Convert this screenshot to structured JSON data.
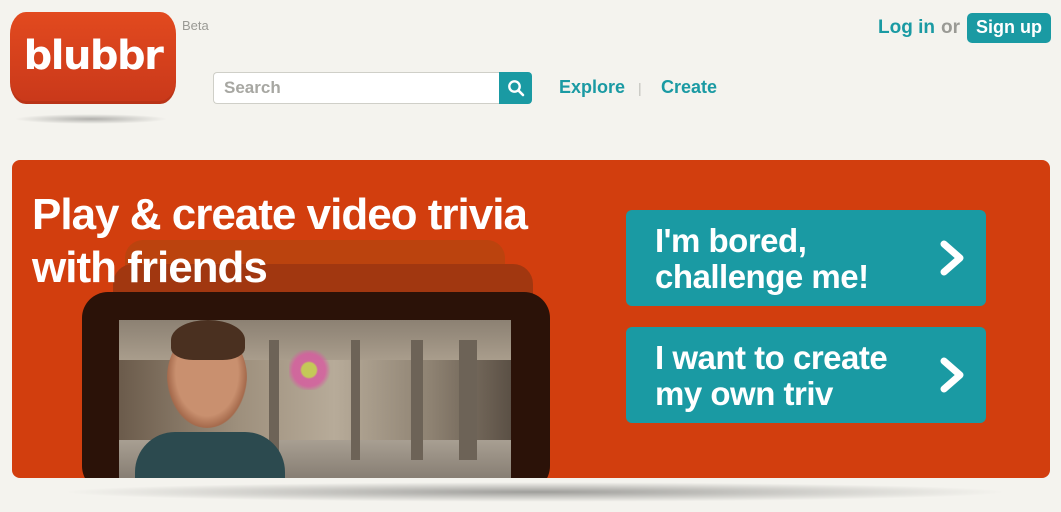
{
  "header": {
    "logo_text": "blubbr",
    "beta_label": "Beta",
    "search": {
      "placeholder": "Search",
      "value": "",
      "button_icon": "search-icon"
    },
    "nav": [
      {
        "label": "Explore"
      },
      {
        "label": "Create"
      }
    ],
    "nav_separator": "|",
    "auth": {
      "login_label": "Log in",
      "or_label": "or",
      "signup_label": "Sign up"
    }
  },
  "hero": {
    "title_line1": "Play & create video trivia",
    "title_line2": "with friends",
    "cta": [
      {
        "line1": "I'm bored,",
        "line2": "challenge me!",
        "icon": "chevron-right-icon"
      },
      {
        "line1": "I want to create",
        "line2": "my own triv",
        "icon": "chevron-right-icon"
      }
    ]
  },
  "colors": {
    "brand_orange": "#d23e0e",
    "logo_red": "#d8431c",
    "accent_teal": "#1a9aa3",
    "background": "#f4f3ee"
  }
}
